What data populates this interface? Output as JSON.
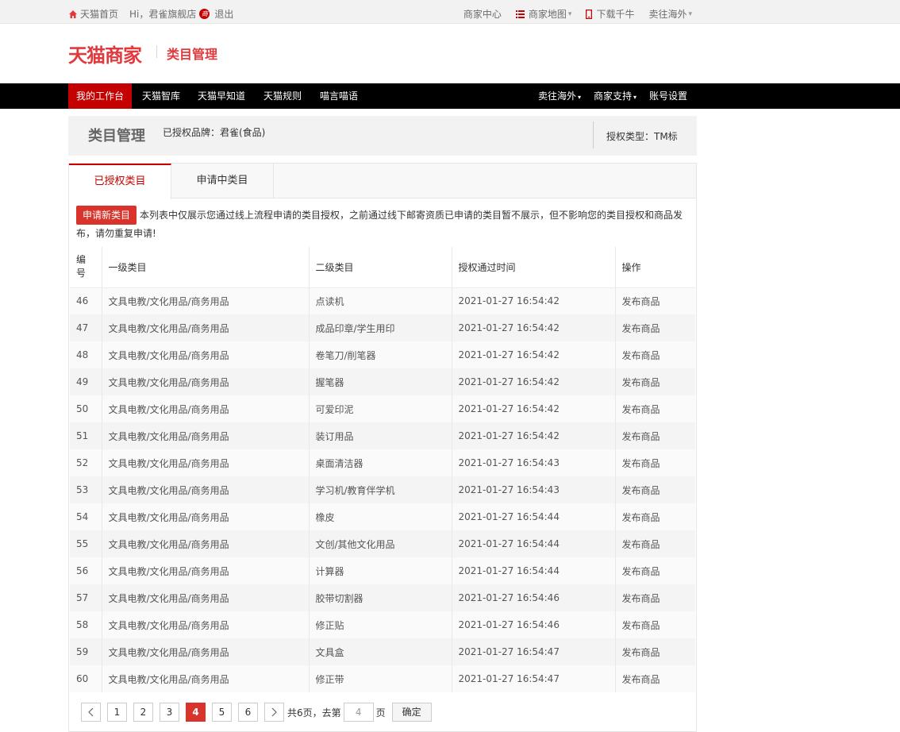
{
  "topbar": {
    "home": "天猫首页",
    "greeting": "Hi，君雀旗舰店",
    "badge": "商",
    "logout": "退出",
    "merchant_center": "商家中心",
    "merchant_map": "商家地图",
    "download": "下载千牛",
    "overseas": "卖往海外"
  },
  "header": {
    "logo": "天猫商家",
    "subtitle": "类目管理"
  },
  "nav": {
    "items": [
      "我的工作台",
      "天猫智库",
      "天猫早知道",
      "天猫规则",
      "喵言喵语"
    ],
    "right": [
      "卖往海外",
      "商家支持",
      "账号设置"
    ]
  },
  "page": {
    "title": "类目管理",
    "brand": "已授权品牌：君雀(食品)",
    "auth_type": "授权类型：TM标"
  },
  "tabs": [
    "已授权类目",
    "申请中类目"
  ],
  "notice": {
    "button": "申请新类目",
    "text": "本列表中仅展示您通过线上流程申请的类目授权，之前通过线下邮寄资质已申请的类目暂不展示，但不影响您的类目授权和商品发布，请勿重复申请!"
  },
  "table": {
    "headers": [
      "编号",
      "一级类目",
      "二级类目",
      "授权通过时间",
      "操作"
    ],
    "rows": [
      [
        "46",
        "文具电教/文化用品/商务用品",
        "点读机",
        "2021-01-27 16:54:42",
        "发布商品"
      ],
      [
        "47",
        "文具电教/文化用品/商务用品",
        "成品印章/学生用印",
        "2021-01-27 16:54:42",
        "发布商品"
      ],
      [
        "48",
        "文具电教/文化用品/商务用品",
        "卷笔刀/削笔器",
        "2021-01-27 16:54:42",
        "发布商品"
      ],
      [
        "49",
        "文具电教/文化用品/商务用品",
        "握笔器",
        "2021-01-27 16:54:42",
        "发布商品"
      ],
      [
        "50",
        "文具电教/文化用品/商务用品",
        "可爱印泥",
        "2021-01-27 16:54:42",
        "发布商品"
      ],
      [
        "51",
        "文具电教/文化用品/商务用品",
        "装订用品",
        "2021-01-27 16:54:42",
        "发布商品"
      ],
      [
        "52",
        "文具电教/文化用品/商务用品",
        "桌面清洁器",
        "2021-01-27 16:54:43",
        "发布商品"
      ],
      [
        "53",
        "文具电教/文化用品/商务用品",
        "学习机/教育伴学机",
        "2021-01-27 16:54:43",
        "发布商品"
      ],
      [
        "54",
        "文具电教/文化用品/商务用品",
        "橡皮",
        "2021-01-27 16:54:44",
        "发布商品"
      ],
      [
        "55",
        "文具电教/文化用品/商务用品",
        "文创/其他文化用品",
        "2021-01-27 16:54:44",
        "发布商品"
      ],
      [
        "56",
        "文具电教/文化用品/商务用品",
        "计算器",
        "2021-01-27 16:54:44",
        "发布商品"
      ],
      [
        "57",
        "文具电教/文化用品/商务用品",
        "胶带切割器",
        "2021-01-27 16:54:46",
        "发布商品"
      ],
      [
        "58",
        "文具电教/文化用品/商务用品",
        "修正贴",
        "2021-01-27 16:54:46",
        "发布商品"
      ],
      [
        "59",
        "文具电教/文化用品/商务用品",
        "文具盒",
        "2021-01-27 16:54:47",
        "发布商品"
      ],
      [
        "60",
        "文具电教/文化用品/商务用品",
        "修正带",
        "2021-01-27 16:54:47",
        "发布商品"
      ]
    ]
  },
  "pager": {
    "pages": [
      "1",
      "2",
      "3",
      "4",
      "5",
      "6"
    ],
    "current": "4",
    "total_text": "共6页，去第",
    "page_suffix": "页",
    "goto_value": "4",
    "confirm": "确定"
  },
  "colors": {
    "brand_red": "#e4393c",
    "nav_active": "#c40000",
    "link": "#3072c2"
  }
}
